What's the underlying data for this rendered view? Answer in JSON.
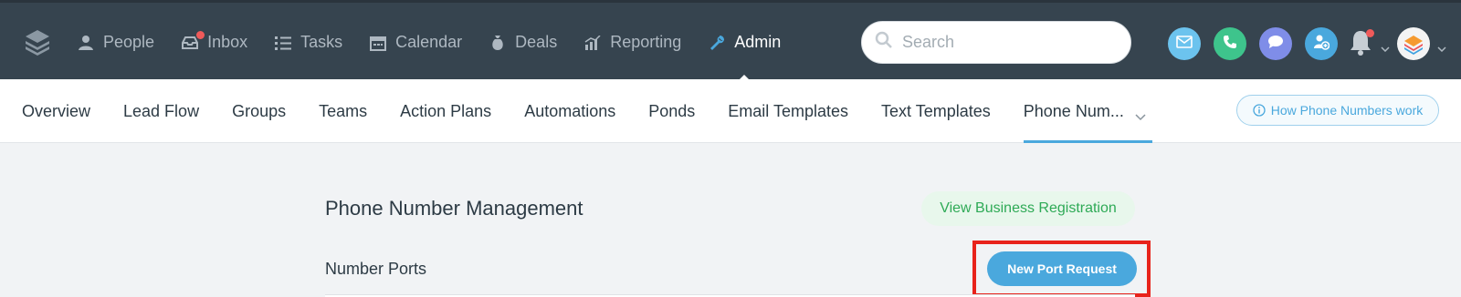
{
  "nav": {
    "items": [
      {
        "label": "People",
        "icon": "person-icon"
      },
      {
        "label": "Inbox",
        "icon": "inbox-icon"
      },
      {
        "label": "Tasks",
        "icon": "tasks-icon"
      },
      {
        "label": "Calendar",
        "icon": "calendar-icon"
      },
      {
        "label": "Deals",
        "icon": "money-bag-icon"
      },
      {
        "label": "Reporting",
        "icon": "bar-chart-icon"
      },
      {
        "label": "Admin",
        "icon": "wrench-icon"
      }
    ],
    "active": "Admin"
  },
  "search": {
    "placeholder": "Search",
    "value": ""
  },
  "quick_actions": [
    {
      "icon": "email-icon",
      "color": "#6cc3ee"
    },
    {
      "icon": "phone-icon",
      "color": "#3ec48c"
    },
    {
      "icon": "chat-icon",
      "color": "#7f8de8"
    },
    {
      "icon": "add-person-icon",
      "color": "#4aa8dd"
    }
  ],
  "subnav": {
    "tabs": [
      {
        "label": "Overview"
      },
      {
        "label": "Lead Flow"
      },
      {
        "label": "Groups"
      },
      {
        "label": "Teams"
      },
      {
        "label": "Action Plans"
      },
      {
        "label": "Automations"
      },
      {
        "label": "Ponds"
      },
      {
        "label": "Email Templates"
      },
      {
        "label": "Text Templates"
      },
      {
        "label": "Phone Num..."
      }
    ],
    "active": "Phone Num...",
    "help_button": "How Phone Numbers work"
  },
  "main": {
    "title": "Phone Number Management",
    "business_button": "View Business Registration",
    "section_title": "Number Ports",
    "new_port_button": "New Port Request"
  },
  "colors": {
    "topbar": "#36444f",
    "accent": "#4aa8dd",
    "notification": "#ef5a5a",
    "highlight": "#e8231b",
    "green": "#2eaa56"
  }
}
